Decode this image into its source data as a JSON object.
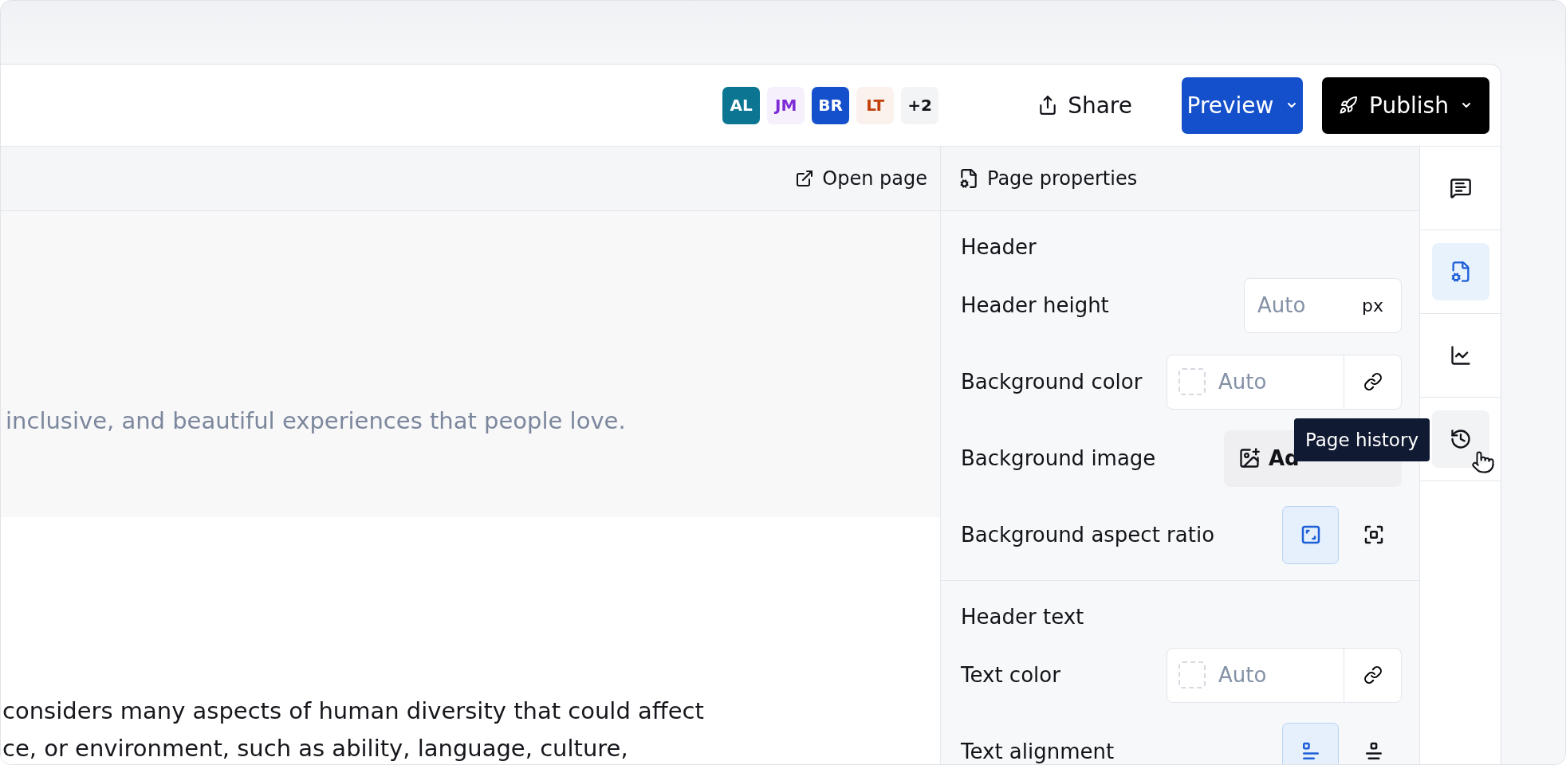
{
  "topbar": {
    "avatars": [
      {
        "kind": "solid",
        "initials": "AL",
        "color": "#0b7592"
      },
      {
        "kind": "soft",
        "initials": "JM",
        "color": "#7e2ad6"
      },
      {
        "kind": "solid",
        "initials": "BR",
        "color": "#1550cc"
      },
      {
        "kind": "soft",
        "initials": "LT",
        "color": "#c2410c"
      },
      {
        "kind": "count",
        "initials": "+2"
      }
    ],
    "share": "Share",
    "preview": "Preview",
    "publish": "Publish"
  },
  "toolbar": {
    "open_page": "Open page"
  },
  "canvas": {
    "hero_text": "inclusive, and beautiful experiences that people love.",
    "body_lines": [
      "considers many aspects of human diversity that could affect",
      "ce, or environment, such as ability, language, culture,"
    ]
  },
  "panel": {
    "title": "Page properties",
    "sections": [
      {
        "title": "Header",
        "rows": [
          {
            "kind": "number",
            "label": "Header height",
            "placeholder": "Auto",
            "unit": "px"
          },
          {
            "kind": "color",
            "label": "Background color",
            "placeholder": "Auto"
          },
          {
            "kind": "image",
            "label": "Background image",
            "button": "Ad"
          },
          {
            "kind": "toggle",
            "label": "Background aspect ratio",
            "options": [
              {
                "kind": "fill",
                "selected": true
              },
              {
                "kind": "fit",
                "selected": false
              }
            ]
          }
        ]
      },
      {
        "title": "Header text",
        "rows": [
          {
            "kind": "color",
            "label": "Text color",
            "placeholder": "Auto"
          },
          {
            "kind": "toggle",
            "label": "Text alignment",
            "options": [
              {
                "kind": "left",
                "selected": true
              },
              {
                "kind": "center",
                "selected": false
              }
            ]
          }
        ]
      }
    ]
  },
  "rail": {
    "items": [
      {
        "kind": "comments",
        "selected": false,
        "hovered": false
      },
      {
        "kind": "properties",
        "selected": true,
        "hovered": false
      },
      {
        "kind": "analytics",
        "selected": false,
        "hovered": false
      },
      {
        "kind": "history",
        "selected": false,
        "hovered": true,
        "tooltip": "Page history"
      }
    ]
  }
}
